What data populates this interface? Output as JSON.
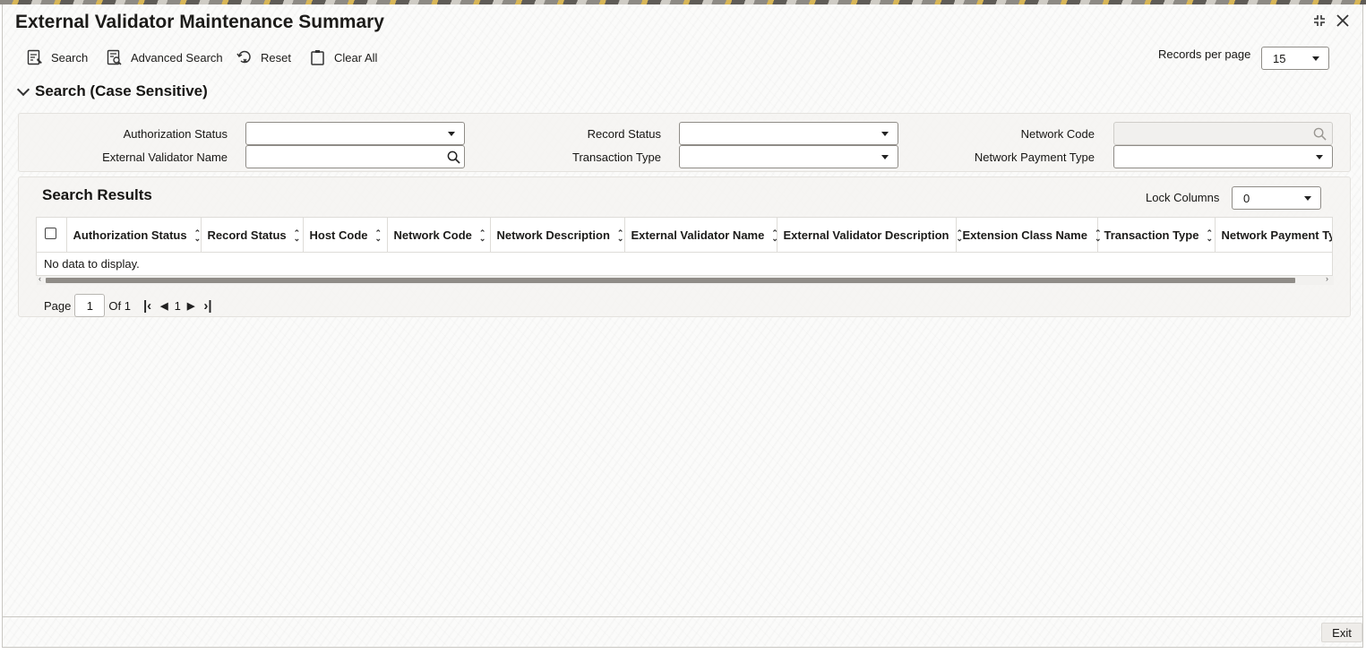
{
  "window": {
    "title": "External Validator Maintenance Summary"
  },
  "toolbar": {
    "search_label": "Search",
    "advanced_search_label": "Advanced Search",
    "reset_label": "Reset",
    "clear_all_label": "Clear All",
    "records_per_page_label": "Records per page",
    "records_per_page_value": "15"
  },
  "search_section": {
    "title": "Search (Case Sensitive)",
    "fields": {
      "authorization_status": {
        "label": "Authorization Status",
        "value": ""
      },
      "record_status": {
        "label": "Record Status",
        "value": ""
      },
      "network_code": {
        "label": "Network Code",
        "value": ""
      },
      "external_validator_name": {
        "label": "External Validator Name",
        "value": ""
      },
      "transaction_type": {
        "label": "Transaction Type",
        "value": ""
      },
      "network_payment_type": {
        "label": "Network Payment Type",
        "value": ""
      }
    }
  },
  "results": {
    "title": "Search Results",
    "lock_columns_label": "Lock Columns",
    "lock_columns_value": "0",
    "columns": [
      "Authorization Status",
      "Record Status",
      "Host Code",
      "Network Code",
      "Network Description",
      "External Validator Name",
      "External Validator Description",
      "Extension Class Name",
      "Transaction Type",
      "Network Payment Type"
    ],
    "empty_message": "No data to display."
  },
  "pagination": {
    "page_label": "Page",
    "current_page": "1",
    "of_label": "Of 1",
    "page_number": "1"
  },
  "footer": {
    "exit_label": "Exit"
  },
  "icons": {
    "search": "search-doc-icon",
    "advanced_search": "advanced-search-icon",
    "reset": "reset-icon",
    "clear_all": "clipboard-icon",
    "lookup": "magnifier-icon"
  }
}
